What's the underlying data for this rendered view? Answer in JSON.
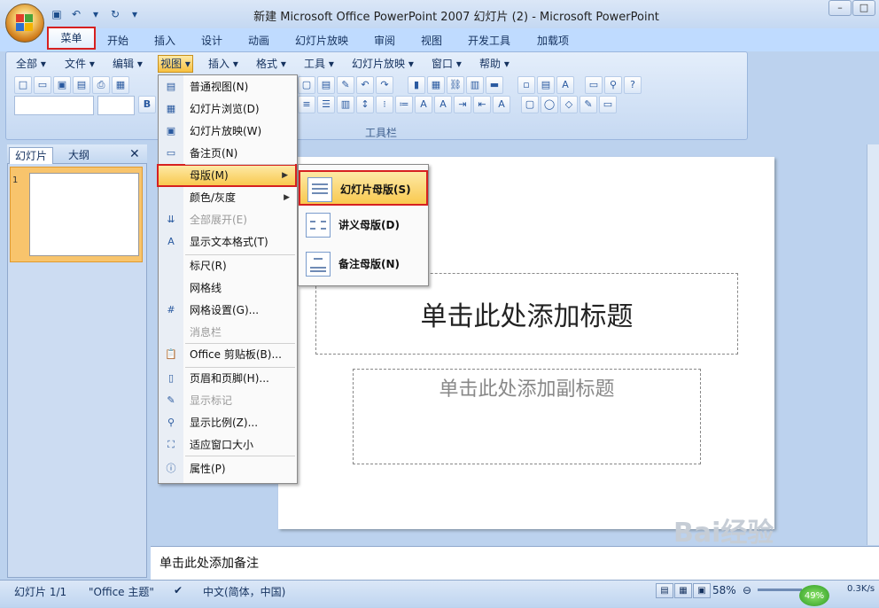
{
  "title_bar": {
    "title": "新建 Microsoft Office PowerPoint 2007 幻灯片 (2) - Microsoft PowerPoint",
    "window_buttons": [
      "–",
      "□"
    ]
  },
  "ribbon_tabs": [
    "菜单",
    "开始",
    "插入",
    "设计",
    "动画",
    "幻灯片放映",
    "审阅",
    "视图",
    "开发工具",
    "加载项"
  ],
  "classic_menus": [
    "全部",
    "文件",
    "编辑",
    "视图",
    "插入",
    "格式",
    "工具",
    "幻灯片放映",
    "窗口",
    "帮助"
  ],
  "toolbar_label": "工具栏",
  "left_panel": {
    "tab_slides": "幻灯片",
    "tab_outline": "大纲",
    "close": "✕",
    "slide_number": "1"
  },
  "slide": {
    "title_placeholder": "单击此处添加标题",
    "subtitle_placeholder": "单击此处添加副标题"
  },
  "notes_placeholder": "单击此处添加备注",
  "view_menu": {
    "items": [
      {
        "label": "普通视图(N)",
        "icon": "normal-view-icon",
        "glyph": "▤",
        "enabled": true
      },
      {
        "label": "幻灯片浏览(D)",
        "icon": "slide-sorter-icon",
        "glyph": "▦",
        "enabled": true
      },
      {
        "label": "幻灯片放映(W)",
        "icon": "slideshow-icon",
        "glyph": "▣",
        "enabled": true
      },
      {
        "label": "备注页(N)",
        "icon": "notes-page-icon",
        "glyph": "▭",
        "enabled": true
      },
      {
        "label": "母版(M)",
        "icon": "",
        "glyph": "",
        "enabled": true,
        "submenu": true
      },
      {
        "label": "颜色/灰度",
        "icon": "",
        "glyph": "",
        "enabled": true,
        "submenu": true
      },
      {
        "label": "全部展开(E)",
        "icon": "expand-all-icon",
        "glyph": "⇊",
        "enabled": false
      },
      {
        "label": "显示文本格式(T)",
        "icon": "text-format-icon",
        "glyph": "A",
        "enabled": true
      },
      {
        "label": "标尺(R)",
        "icon": "",
        "glyph": "",
        "enabled": true
      },
      {
        "label": "网格线",
        "icon": "",
        "glyph": "",
        "enabled": true
      },
      {
        "label": "网格设置(G)...",
        "icon": "grid-settings-icon",
        "glyph": "#",
        "enabled": true
      },
      {
        "label": "消息栏",
        "icon": "",
        "glyph": "",
        "enabled": false
      },
      {
        "label": "Office 剪贴板(B)...",
        "icon": "clipboard-icon",
        "glyph": "📋",
        "enabled": true
      },
      {
        "label": "页眉和页脚(H)...",
        "icon": "header-footer-icon",
        "glyph": "▯",
        "enabled": true
      },
      {
        "label": "显示标记",
        "icon": "markup-icon",
        "glyph": "✎",
        "enabled": false
      },
      {
        "label": "显示比例(Z)...",
        "icon": "zoom-icon",
        "glyph": "⚲",
        "enabled": true
      },
      {
        "label": "适应窗口大小",
        "icon": "fit-window-icon",
        "glyph": "⛶",
        "enabled": true
      },
      {
        "label": "属性(P)",
        "icon": "properties-icon",
        "glyph": "ⓘ",
        "enabled": true
      }
    ]
  },
  "master_submenu": [
    {
      "label": "幻灯片母版(S)",
      "icon": "slide-master-icon"
    },
    {
      "label": "讲义母版(D)",
      "icon": "handout-master-icon"
    },
    {
      "label": "备注母版(N)",
      "icon": "notes-master-icon"
    }
  ],
  "status_bar": {
    "slide_info": "幻灯片 1/1",
    "theme": "\"Office 主题\"",
    "language": "中文(简体，中国)",
    "zoom": "58%",
    "net_percent": "49%",
    "net_speed": "0.3K/s"
  },
  "watermark": "Bai经验",
  "colors": {
    "highlight_border": "#d62020",
    "menu_hover": "#f9c94f",
    "ribbon_bg": "#bfdbff"
  }
}
